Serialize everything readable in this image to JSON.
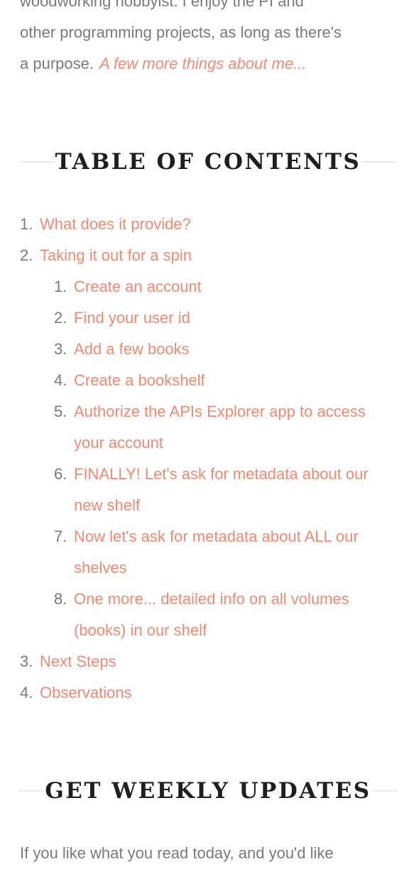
{
  "intro": {
    "lines": [
      "woodworking hobbyist. I enjoy the PI and",
      "other programming projects, as long as there's",
      "a purpose."
    ],
    "more_link": "A few more things about me..."
  },
  "toc": {
    "title": "TABLE OF CONTENTS",
    "items": [
      {
        "num": "1.",
        "label": "What does it provide?"
      },
      {
        "num": "2.",
        "label": "Taking it out for a spin",
        "children": [
          {
            "num": "1.",
            "label": "Create an account"
          },
          {
            "num": "2.",
            "label": "Find your user id"
          },
          {
            "num": "3.",
            "label": "Add a few books"
          },
          {
            "num": "4.",
            "label": "Create a bookshelf"
          },
          {
            "num": "5.",
            "label": "Authorize the APIs Explorer app to access your account"
          },
          {
            "num": "6.",
            "label": "FINALLY! Let's ask for metadata about our new shelf"
          },
          {
            "num": "7.",
            "label": "Now let's ask for metadata about ALL our shelves"
          },
          {
            "num": "8.",
            "label": "One more... detailed info on all volumes (books) in our shelf"
          }
        ]
      },
      {
        "num": "3.",
        "label": "Next Steps"
      },
      {
        "num": "4.",
        "label": "Observations"
      }
    ]
  },
  "updates": {
    "title": "GET WEEKLY UPDATES",
    "text": "If you like what you read today, and you'd like"
  },
  "colors": {
    "link": "#f28a72",
    "body_text": "#7a7a7a",
    "heading": "#1f1f1f",
    "divider": "#ececec"
  }
}
